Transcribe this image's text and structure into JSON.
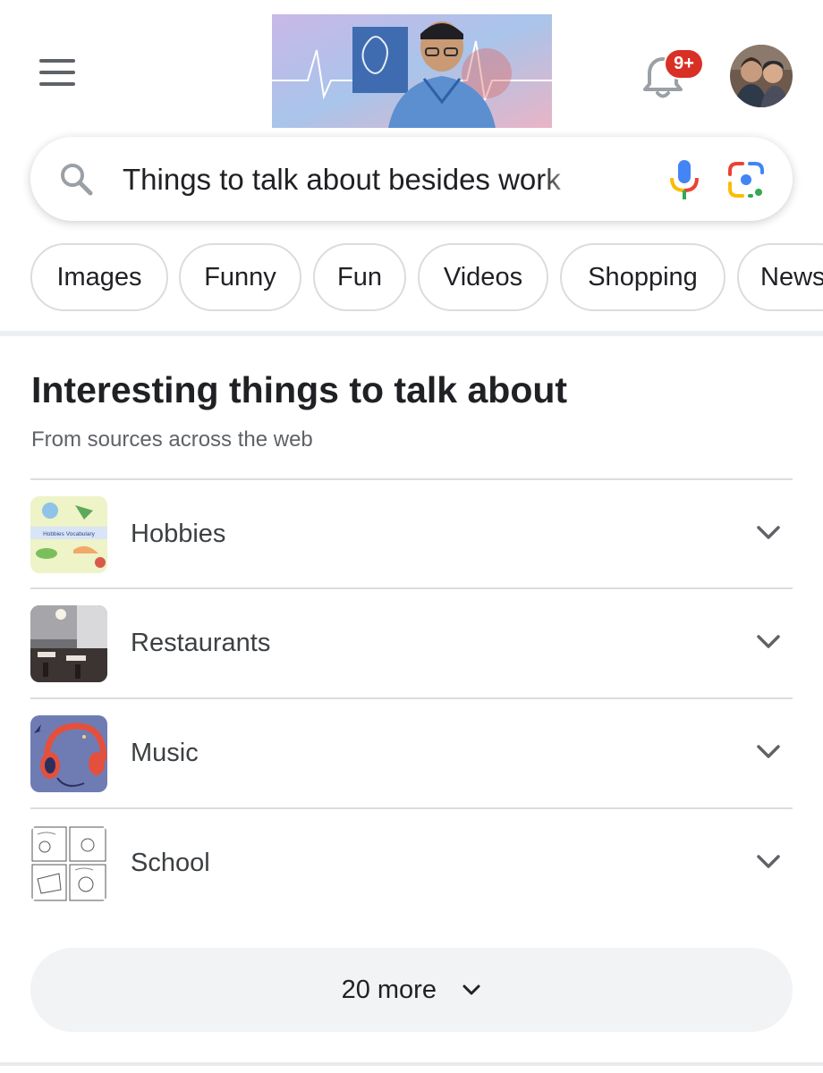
{
  "header": {
    "notification_badge": "9+",
    "brand_color": "#d93025"
  },
  "search": {
    "query": "Things to talk about besides work"
  },
  "chips": [
    {
      "label": "Images"
    },
    {
      "label": "Funny"
    },
    {
      "label": "Fun"
    },
    {
      "label": "Videos"
    },
    {
      "label": "Shopping"
    },
    {
      "label": "News"
    }
  ],
  "section": {
    "title": "Interesting things to talk about",
    "subtitle": "From sources across the web",
    "items": [
      {
        "label": "Hobbies",
        "thumb_text": "Hobbies Vocabulary"
      },
      {
        "label": "Restaurants"
      },
      {
        "label": "Music"
      },
      {
        "label": "School"
      }
    ],
    "more_label": "20 more"
  }
}
